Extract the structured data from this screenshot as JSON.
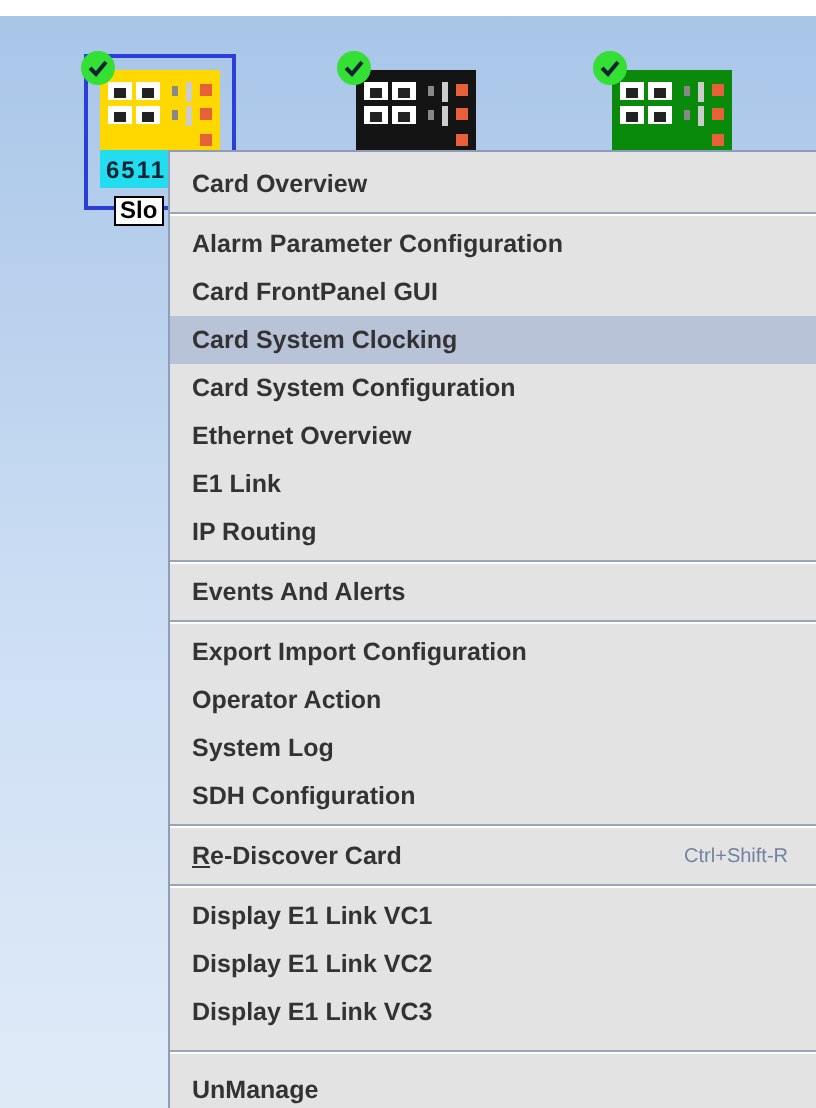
{
  "cards": [
    {
      "color": "#ffd800",
      "healthy": true,
      "selected": true,
      "code": "6511",
      "slot_label": "Slo"
    },
    {
      "color": "#141414",
      "healthy": true,
      "selected": false
    },
    {
      "color": "#0a8a0a",
      "healthy": true,
      "selected": false
    }
  ],
  "context_menu": {
    "groups": [
      [
        {
          "label": "Card Overview",
          "selected": false
        }
      ],
      [
        {
          "label": "Alarm Parameter Configuration",
          "selected": false
        },
        {
          "label": "Card FrontPanel GUI",
          "selected": false
        },
        {
          "label": "Card System Clocking",
          "selected": true
        },
        {
          "label": "Card System Configuration",
          "selected": false
        },
        {
          "label": "Ethernet Overview",
          "selected": false
        },
        {
          "label": "E1 Link",
          "selected": false
        },
        {
          "label": "IP Routing",
          "selected": false
        }
      ],
      [
        {
          "label": "Events And Alerts",
          "selected": false
        }
      ],
      [
        {
          "label": "Export Import Configuration",
          "selected": false
        },
        {
          "label": "Operator Action",
          "selected": false
        },
        {
          "label": "System Log",
          "selected": false
        },
        {
          "label": "SDH Configuration",
          "selected": false
        }
      ],
      [
        {
          "label": "Re-Discover Card",
          "selected": false,
          "mnemonic_underlined": true,
          "shortcut": "Ctrl+Shift-R"
        }
      ],
      [
        {
          "label": "Display E1 Link VC1",
          "selected": false
        },
        {
          "label": "Display E1 Link VC2",
          "selected": false
        },
        {
          "label": "Display E1 Link VC3",
          "selected": false
        }
      ],
      [
        {
          "label": "UnManage",
          "selected": false
        }
      ]
    ]
  }
}
